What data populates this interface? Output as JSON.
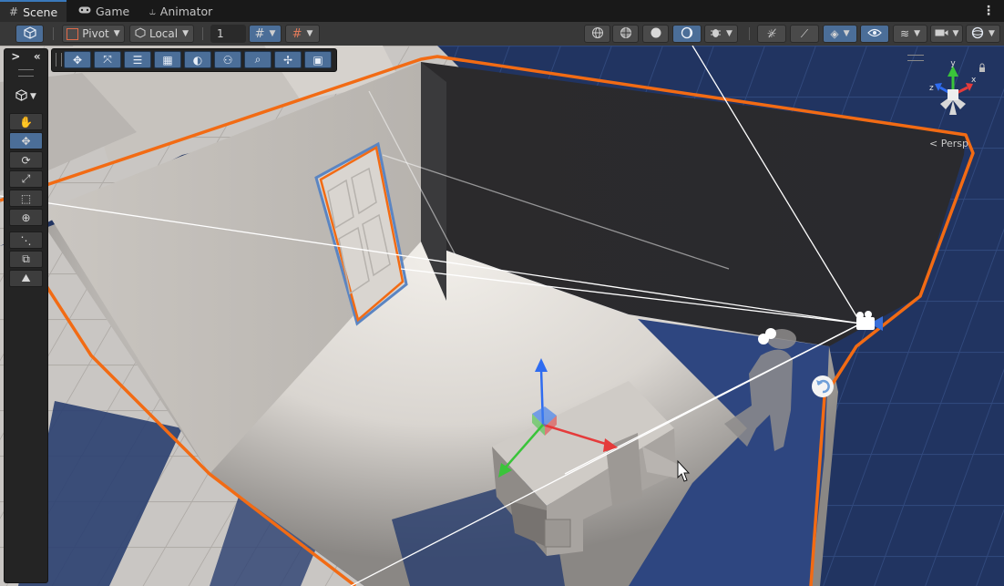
{
  "tabs": [
    {
      "label": "Scene",
      "icon": "grid-icon",
      "active": true
    },
    {
      "label": "Game",
      "icon": "gamepad-icon",
      "active": false
    },
    {
      "label": "Animator",
      "icon": "animator-icon",
      "active": false
    }
  ],
  "toolbar": {
    "pivot_label": "Pivot",
    "local_label": "Local",
    "snap_increment": "1"
  },
  "tool_panel": {
    "expand_label": ">",
    "collapse_label": "«",
    "selected_tool": "move"
  },
  "viewport": {
    "projection_label": "< Persp",
    "gizmo_axes": [
      "y",
      "x",
      "z"
    ]
  },
  "colors": {
    "selection_outline": "#f26b14",
    "door_outline": "#5b85c2",
    "axis_x": "#e53b3b",
    "axis_y": "#3ac43a",
    "axis_z": "#2f6cf0",
    "active_button": "#4b6e98"
  }
}
